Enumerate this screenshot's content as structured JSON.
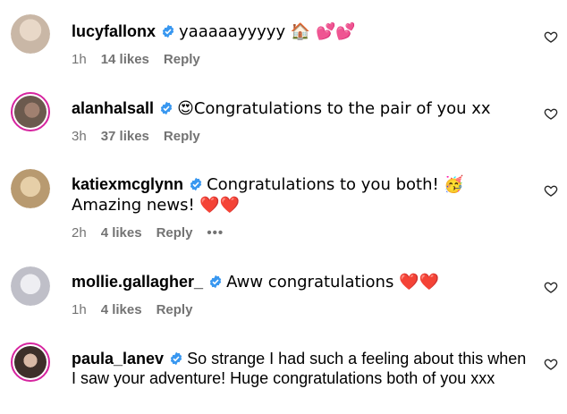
{
  "comments": [
    {
      "username": "lucyfallonx",
      "text": "yaaaaayyyyy 🏠 💕💕",
      "time": "1h",
      "likes": "14 likes",
      "reply": "Reply",
      "avatar_ring": false,
      "avatar_color": "#c9b7a6"
    },
    {
      "username": "alanhalsall",
      "text": "😍Congratulations to the pair of you xx",
      "time": "3h",
      "likes": "37 likes",
      "reply": "Reply",
      "avatar_ring": true,
      "avatar_color": "#6b5a4e"
    },
    {
      "username": "katiexmcglynn",
      "text": "Congratulations to you both! 🥳 Amazing news! ❤️❤️",
      "time": "2h",
      "likes": "4 likes",
      "reply": "Reply",
      "more": "•••",
      "avatar_ring": false,
      "avatar_color": "#d8b98e"
    },
    {
      "username": "mollie.gallagher_",
      "text": "Aww congratulations ❤️❤️",
      "time": "1h",
      "likes": "4 likes",
      "reply": "Reply",
      "avatar_ring": false,
      "avatar_color": "#cfcfd6"
    },
    {
      "username": "paula_lanev",
      "text": "So strange I had such a feeling about this when I saw your adventure! Huge congratulations both of you xxx",
      "avatar_ring": true,
      "avatar_color": "#3e2f2a"
    }
  ],
  "colors": {
    "verified": "#3897f0",
    "ring": "#d6249f",
    "meta": "#737373"
  },
  "icons": {
    "verified": "verified-badge-icon",
    "like": "heart-outline-icon"
  }
}
